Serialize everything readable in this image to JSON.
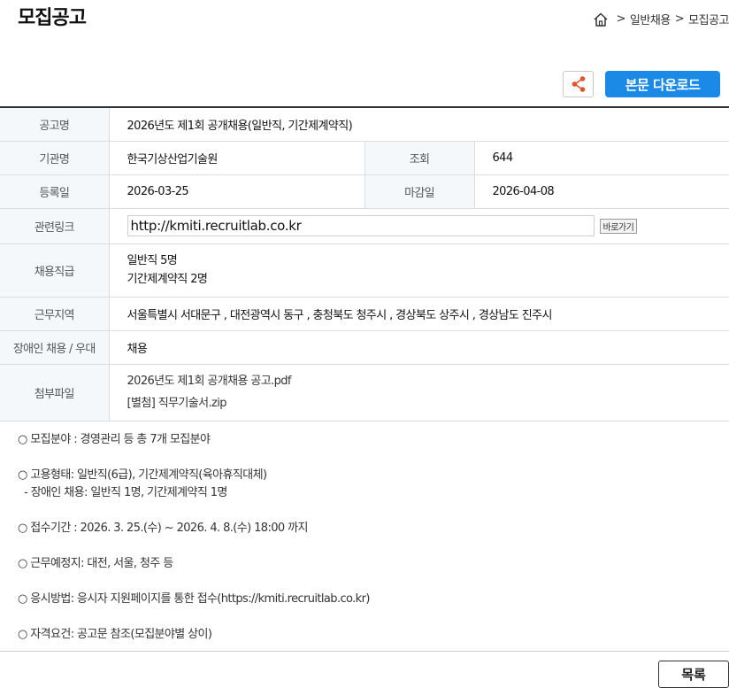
{
  "page": {
    "title": "모집공고"
  },
  "breadcrumb": {
    "items": [
      "일반채용",
      "모집공고"
    ],
    "separator": ">"
  },
  "toolbar": {
    "download_label": "본문 다운로드"
  },
  "info": {
    "title_label": "공고명",
    "title_value": "2026년도 제1회 공개채용(일반직, 기간제계약직)",
    "org_label": "기관명",
    "org_value": "한국기상산업기술원",
    "views_label": "조회",
    "views_value": "644",
    "reg_label": "등록일",
    "reg_value": "2026-03-25",
    "deadline_label": "마감일",
    "deadline_value": "2026-04-08",
    "link_label": "관련링크",
    "link_value": "http://kmiti.recruitlab.co.kr",
    "link_go_label": "바로가기",
    "job_label": "채용직급",
    "job_lines": [
      "일반직 5명",
      "기간제계약직 2명"
    ],
    "region_label": "근무지역",
    "region_value": "서울특별시 서대문구 , 대전광역시 동구 , 충청북도 청주시 , 경상북도 상주시 , 경상남도 진주시",
    "disabled_label": "장애인 채용 / 우대",
    "disabled_value": "채용",
    "files_label": "첨부파일",
    "files": [
      "2026년도 제1회 공개채용 공고.pdf",
      "[별첨] 직무기술서.zip"
    ]
  },
  "body_lines": [
    "○ 모집분야 : 경영관리 등 총 7개 모집분야",
    "",
    "○ 고용형태: 일반직(6급), 기간제계약직(육아휴직대체)",
    "  - 장애인 채용: 일반직 1명, 기간제계약직 1명",
    "",
    "○ 접수기간 : 2026. 3. 25.(수) ~ 2026. 4. 8.(수) 18:00 까지",
    "",
    "○ 근무예정지: 대전, 서울, 청주 등",
    "",
    "○ 응시방법: 응시자 지원페이지를 통한 접수(https://kmiti.recruitlab.co.kr)",
    "",
    "○ 자격요건: 공고문 참조(모집분야별 상이)"
  ],
  "footer": {
    "list_label": "목록"
  }
}
